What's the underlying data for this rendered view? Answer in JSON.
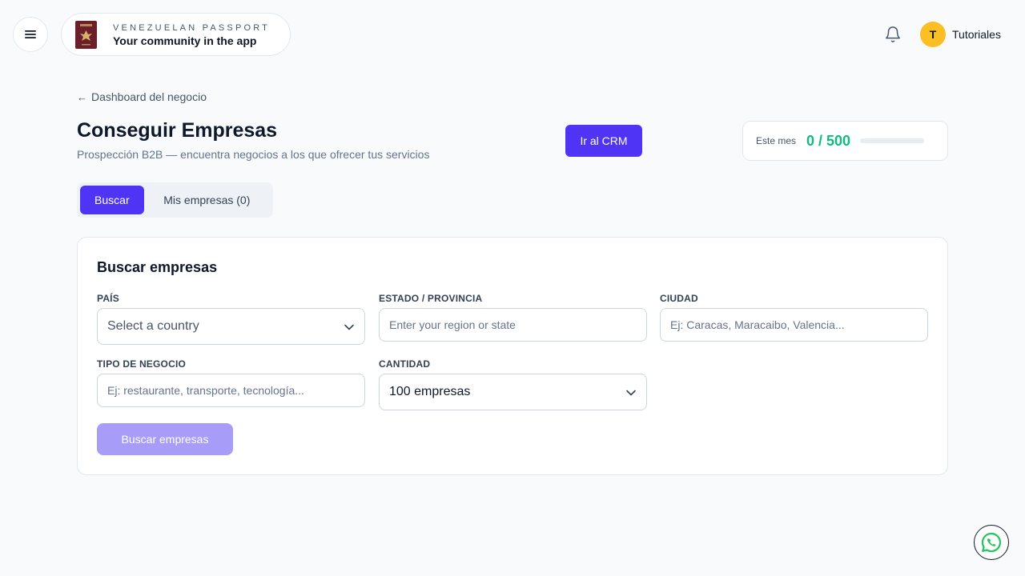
{
  "header": {
    "brand_kicker": "VENEZUELAN PASSPORT",
    "brand_title": "Your community in the app",
    "user_initial": "T",
    "user_name": "Tutoriales"
  },
  "page": {
    "back_label": "Dashboard del negocio",
    "title": "Conseguir Empresas",
    "subtitle": "Prospección B2B — encuentra negocios a los que ofrecer tus servicios",
    "crm_button": "Ir al CRM",
    "quota_label": "Este mes",
    "quota_value": "0 / 500",
    "quota_used": 0,
    "quota_limit": 500
  },
  "tabs": [
    {
      "label": "Buscar",
      "active": true
    },
    {
      "label": "Mis empresas (0)",
      "active": false
    }
  ],
  "search_card": {
    "title": "Buscar empresas",
    "country_label": "PAÍS",
    "country_value": "Select a country",
    "state_label": "ESTADO / PROVINCIA",
    "state_placeholder": "Enter your region or state",
    "city_label": "CIUDAD",
    "city_placeholder": "Ej: Caracas, Maracaibo, Valencia...",
    "business_label": "TIPO DE NEGOCIO",
    "business_placeholder": "Ej: restaurante, transporte, tecnología...",
    "quantity_label": "CANTIDAD",
    "quantity_value": "100 empresas",
    "submit_label": "Buscar empresas"
  },
  "colors": {
    "primary": "#4f34f5",
    "primary_disabled": "#a79cf8",
    "quota_green": "#10b981",
    "avatar": "#fbbf24"
  },
  "icons": {
    "menu": "menu-icon",
    "notifications": "bell-icon",
    "back": "arrow-left-icon",
    "dropdown": "chevron-down-icon",
    "chat": "whatsapp-icon",
    "brand": "passport-icon"
  }
}
